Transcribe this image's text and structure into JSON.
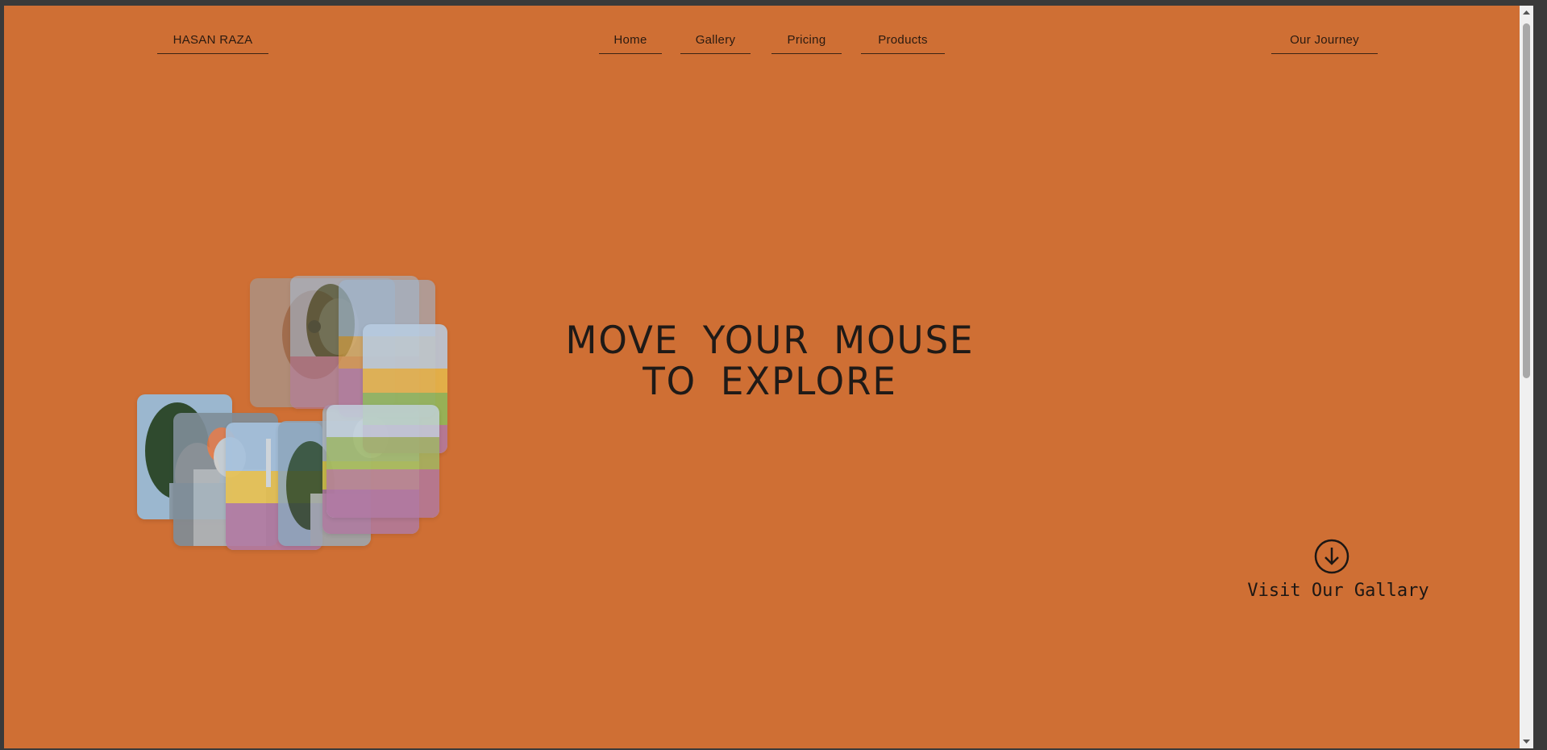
{
  "nav": {
    "brand": "HASAN RAZA",
    "links": [
      "Home",
      "Gallery",
      "Pricing",
      "Products"
    ],
    "journey": "Our Journey"
  },
  "hero": {
    "line1": "MOVE YOUR MOUSE",
    "line2": "TO EXPLORE"
  },
  "cta": {
    "label": "Visit Our Gallary",
    "icon": "arrow-down-circle-icon"
  },
  "colors": {
    "background": "#cf6f34",
    "text": "#1f1a17"
  }
}
